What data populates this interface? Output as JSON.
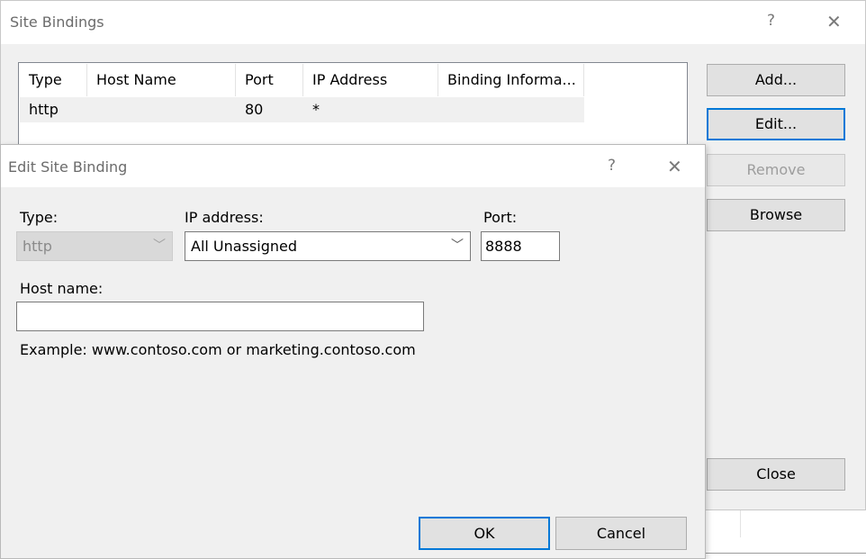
{
  "site_bindings": {
    "title": "Site Bindings",
    "help_glyph": "?",
    "close_glyph": "✕",
    "columns": [
      "Type",
      "Host Name",
      "Port",
      "IP Address",
      "Binding Informa..."
    ],
    "rows": [
      {
        "type": "http",
        "host_name": "",
        "port": "80",
        "ip_address": "*",
        "binding_info": ""
      }
    ],
    "buttons": {
      "add": "Add...",
      "edit": "Edit...",
      "remove": "Remove",
      "browse": "Browse",
      "close": "Close"
    }
  },
  "edit_site_binding": {
    "title": "Edit Site Binding",
    "help_glyph": "?",
    "close_glyph": "✕",
    "type_label": "Type:",
    "type_value": "http",
    "ip_label": "IP address:",
    "ip_value": "All Unassigned",
    "port_label": "Port:",
    "port_value": "8888",
    "host_label": "Host name:",
    "host_value": "",
    "example": "Example: www.contoso.com or marketing.contoso.com",
    "ok": "OK",
    "cancel": "Cancel"
  },
  "icons": {
    "dropdown": "chevron-down-icon"
  },
  "colors": {
    "focus_accent": "#0078d7",
    "dialog_bg": "#f0f0f0",
    "button_bg": "#e1e1e1"
  }
}
